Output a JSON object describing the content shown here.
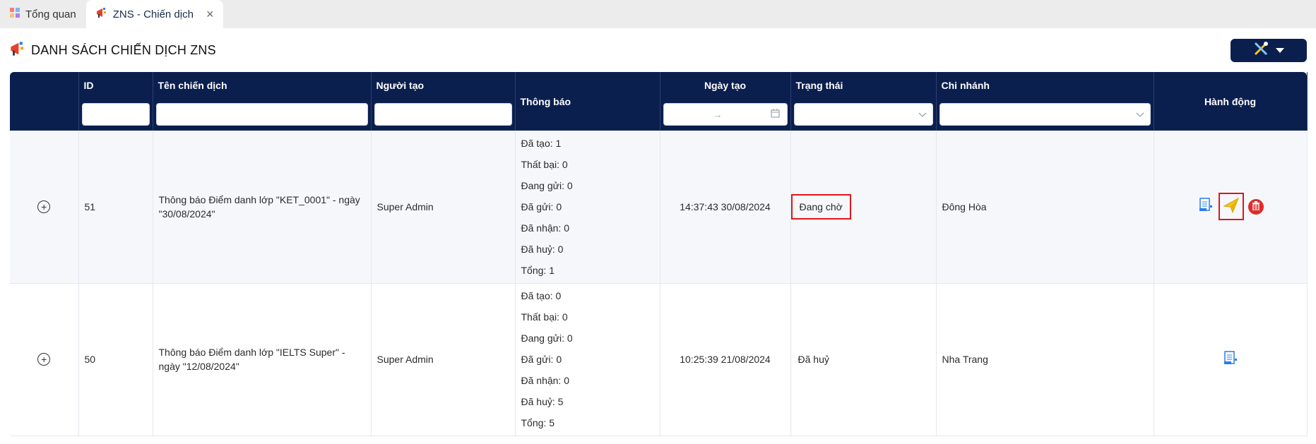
{
  "tabs": [
    {
      "label": "Tổng quan",
      "icon": "dashboard-icon"
    },
    {
      "label": "ZNS - Chiến dịch",
      "icon": "zns-megaphone-icon"
    }
  ],
  "page": {
    "title": "DANH SÁCH CHIẾN DỊCH ZNS"
  },
  "colors": {
    "header_bg": "#0b1f4f",
    "highlight": "#e0161b",
    "delete": "#e02b2b",
    "send": "#f5c518"
  },
  "table": {
    "columns": {
      "id": "ID",
      "name": "Tên chiến dịch",
      "creator": "Người tạo",
      "notice": "Thông báo",
      "created": "Ngày tạo",
      "status": "Trạng thái",
      "branch": "Chi nhánh",
      "actions": "Hành động"
    },
    "rows": [
      {
        "id": "51",
        "name": "Thông báo Điểm danh lớp \"KET_0001\" - ngày \"30/08/2024\"",
        "creator": "Super Admin",
        "stats": [
          "Đã tạo: 1",
          "Thất bại: 0",
          "Đang gửi: 0",
          "Đã gửi: 0",
          "Đã nhận: 0",
          "Đã huỷ: 0",
          "Tổng: 1"
        ],
        "created": "14:37:43 30/08/2024",
        "status": "Đang chờ",
        "branch": "Đông Hòa"
      },
      {
        "id": "50",
        "name": "Thông báo Điểm danh lớp \"IELTS Super\" - ngày \"12/08/2024\"",
        "creator": "Super Admin",
        "stats": [
          "Đã tạo: 0",
          "Thất bại: 0",
          "Đang gửi: 0",
          "Đã gửi: 0",
          "Đã nhận: 0",
          "Đã huỷ: 5",
          "Tổng: 5"
        ],
        "created": "10:25:39 21/08/2024",
        "status": "Đã huỷ",
        "branch": "Nha Trang"
      }
    ]
  }
}
